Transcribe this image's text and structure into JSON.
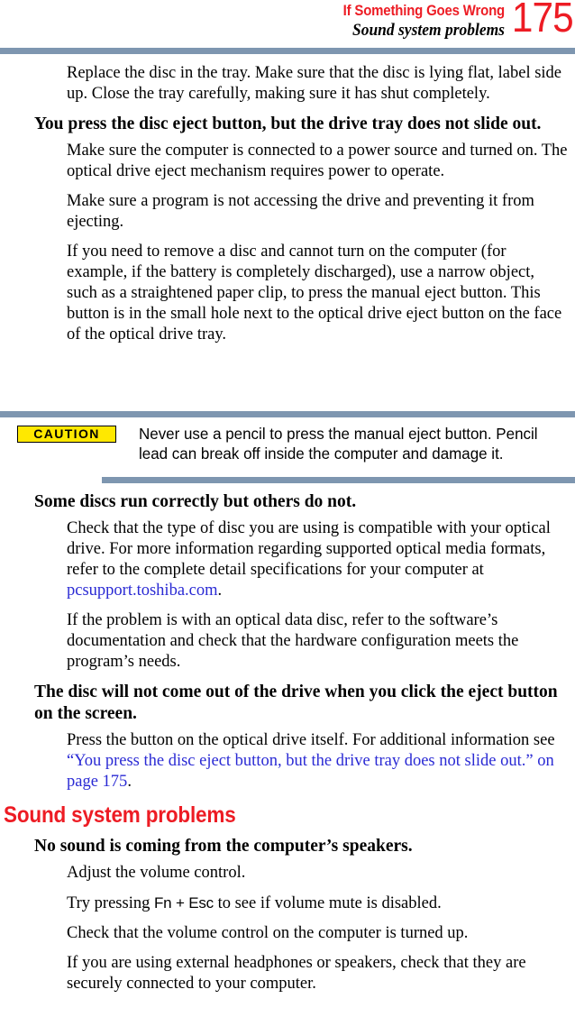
{
  "header": {
    "chapter": "If Something Goes Wrong",
    "section": "Sound system problems",
    "page_number": "175",
    "accent_red": "#ED1C24",
    "rule_color": "#7E96B0"
  },
  "body": {
    "p_replace_disc": "Replace the disc in the tray. Make sure that the disc is lying flat, label side up. Close the tray carefully, making sure it has shut completely.",
    "h_eject_button": "You press the disc eject button, but the drive tray does not slide out.",
    "p_power_source": "Make sure the computer is connected to a power source and turned on. The optical drive eject mechanism requires power to operate.",
    "p_program_accessing": "Make sure a program is not accessing the drive and preventing it from ejecting.",
    "p_manual_eject": "If you need to remove a disc and cannot turn on the computer (for example, if the battery is completely discharged), use a narrow object, such as a straightened paper clip, to press the manual eject button. This button is in the small hole next to the optical drive eject button on the face of the optical drive tray.",
    "h_some_discs": "Some discs run correctly but others do not.",
    "p_check_type_pre": "Check that the type of disc you are using is compatible with your optical drive. For more information regarding supported optical media formats, refer to the complete detail specifications for your computer at ",
    "p_check_type_link": "pcsupport.toshiba.com",
    "p_check_type_post": ".",
    "p_data_disc": "If the problem is with an optical data disc, refer to the software’s documentation and check that the hardware configuration meets the program’s needs.",
    "h_disc_not_come_out": "The disc will not come out of the drive when you click the eject button on the screen.",
    "p_press_button_pre": "Press the button on the optical drive itself. For additional information see ",
    "p_press_button_link": "“You press the disc eject button, but the drive tray does not slide out.” on page 175",
    "p_press_button_post": ".",
    "h_sound_system": "Sound system problems",
    "h_no_sound": "No sound is coming from the computer’s speakers.",
    "p_adjust_volume": "Adjust the volume control.",
    "p_try_pressing_pre": "Try pressing ",
    "p_try_pressing_keys": "Fn + Esc",
    "p_try_pressing_post": " to see if volume mute is disabled.",
    "p_check_volume": "Check that the volume control on the computer is turned up.",
    "p_external_headphones": "If you are using external headphones or speakers, check that they are securely connected to your computer.",
    "link_color": "#2A2AD4"
  },
  "caution": {
    "badge_label": "CAUTION",
    "text": "Never use a pencil to press the manual eject button. Pencil lead can break off inside the computer and damage it.",
    "badge_background": "#FFE800",
    "badge_border": "#000000"
  }
}
